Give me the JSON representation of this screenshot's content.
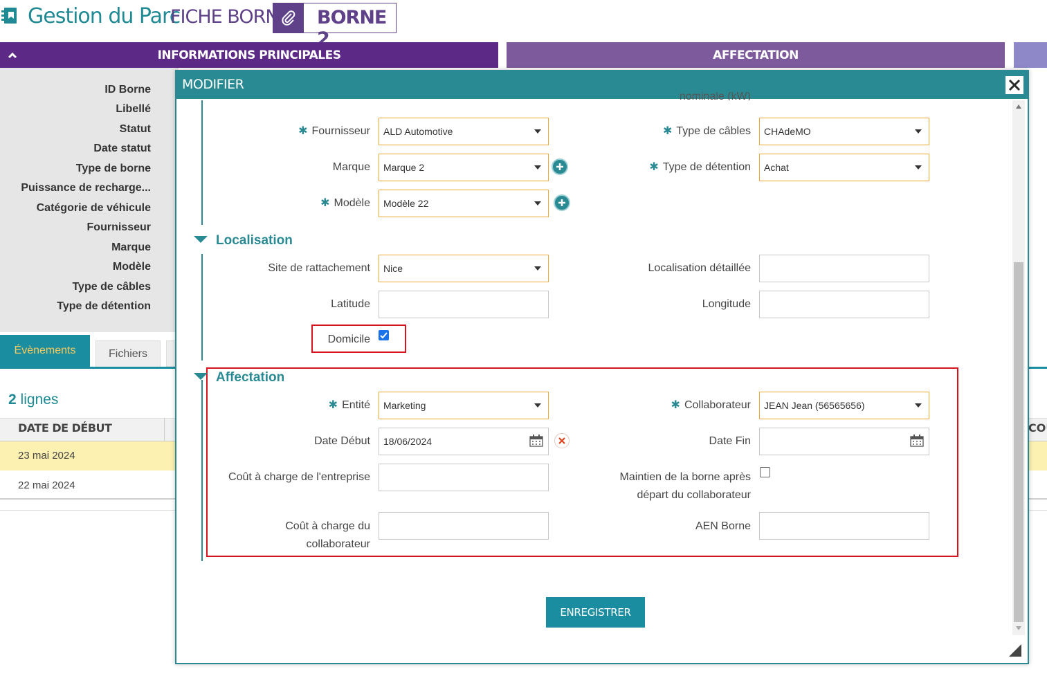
{
  "header": {
    "app_title": "Gestion du Parc",
    "page_name": "FICHE BORNE",
    "record_title": "BORNE 2"
  },
  "sections": {
    "main_title": "INFORMATIONS PRINCIPALES",
    "affectation_title": "AFFECTATION"
  },
  "info_labels": [
    "ID Borne",
    "Libellé",
    "Statut",
    "Date statut",
    "Type de borne",
    "Puissance de recharge...",
    "Catégorie de véhicule",
    "Fournisseur",
    "Marque",
    "Modèle",
    "Type de câbles",
    "Type de détention"
  ],
  "tabs": {
    "events": "Évènements",
    "files": "Fichiers"
  },
  "list": {
    "count": "2",
    "count_suffix": " lignes",
    "col_start_date": "DATE DE DÉBUT",
    "col_cost": "COÛ",
    "rows": [
      "23 mai 2024",
      "22 mai 2024"
    ]
  },
  "modal": {
    "title": "MODIFIER",
    "cut_label": "nominale (kW)",
    "fields": {
      "fournisseur_label": "Fournisseur",
      "fournisseur_value": "ALD Automotive",
      "type_cables_label": "Type de câbles",
      "type_cables_value": "CHAdeMO",
      "marque_label": "Marque",
      "marque_value": "Marque 2",
      "type_detention_label": "Type de détention",
      "type_detention_value": "Achat",
      "modele_label": "Modèle",
      "modele_value": "Modèle 22"
    },
    "localisation": {
      "title": "Localisation",
      "site_label": "Site de rattachement",
      "site_value": "Nice",
      "loc_detail_label": "Localisation détaillée",
      "latitude_label": "Latitude",
      "longitude_label": "Longitude",
      "domicile_label": "Domicile",
      "domicile_checked": true
    },
    "affectation": {
      "title": "Affectation",
      "entite_label": "Entité",
      "entite_value": "Marketing",
      "collab_label": "Collaborateur",
      "collab_value": "JEAN Jean (56565656)",
      "date_debut_label": "Date Début",
      "date_debut_value": "18/06/2024",
      "date_fin_label": "Date Fin",
      "cout_entreprise_label": "Coût à charge de l'entreprise",
      "maintien_label_1": "Maintien de la borne après",
      "maintien_label_2": "départ du collaborateur",
      "maintien_checked": false,
      "cout_collab_label_1": "Coût à charge du",
      "cout_collab_label_2": "collaborateur",
      "aen_label": "AEN Borne"
    },
    "save_label": "ENREGISTRER"
  },
  "colors": {
    "teal": "#2a8a93",
    "purple": "#5c2a86",
    "required_border": "#f0a830",
    "highlight_red": "#d8121f"
  }
}
